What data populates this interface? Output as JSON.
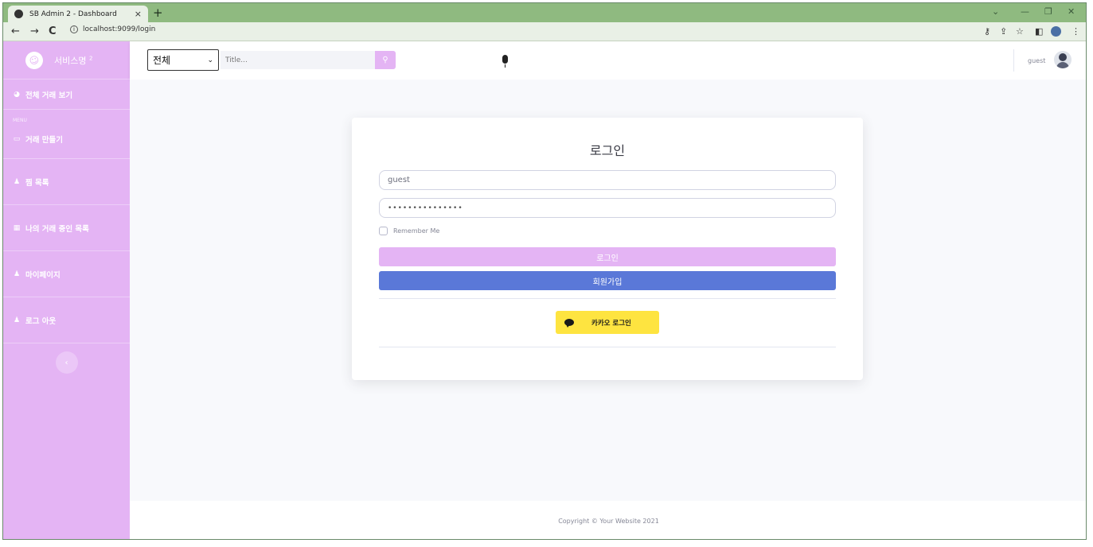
{
  "browser": {
    "tab_title": "SB Admin 2 - Dashboard",
    "tab_close": "×",
    "new_tab": "+",
    "url": "localhost:9099/login",
    "back": "←",
    "forward": "→",
    "reload": "C"
  },
  "sidebar": {
    "brand": "서비스명",
    "brand_sup": "2",
    "menu_heading": "MENU",
    "items": [
      {
        "label": "전체 거래 보기",
        "icon": "tachometer-icon"
      },
      {
        "label": "거래 만들기",
        "icon": "card-icon"
      },
      {
        "label": "찜 목록",
        "icon": "user-icon"
      },
      {
        "label": "나의 거래 중인 목록",
        "icon": "table-icon"
      },
      {
        "label": "마이페이지",
        "icon": "user-icon"
      },
      {
        "label": "로그 아웃",
        "icon": "user-icon"
      }
    ],
    "toggle": "‹"
  },
  "topbar": {
    "category_selected": "전체",
    "search_placeholder": "Title...",
    "user_name": "guest"
  },
  "login": {
    "title": "로그인",
    "username_value": "guest",
    "password_value": "•••••••••••••••",
    "remember_label": "Remember Me",
    "login_button": "로그인",
    "signup_button": "회원가입",
    "kakao_button": "카카오 로그인"
  },
  "footer": {
    "copyright": "Copyright © Your Website 2021"
  },
  "colors": {
    "sidebar_bg": "#e4b4f4",
    "signup_button": "#5a78d8",
    "kakao_button": "#fee440",
    "browser_frame": "#8fba80"
  }
}
